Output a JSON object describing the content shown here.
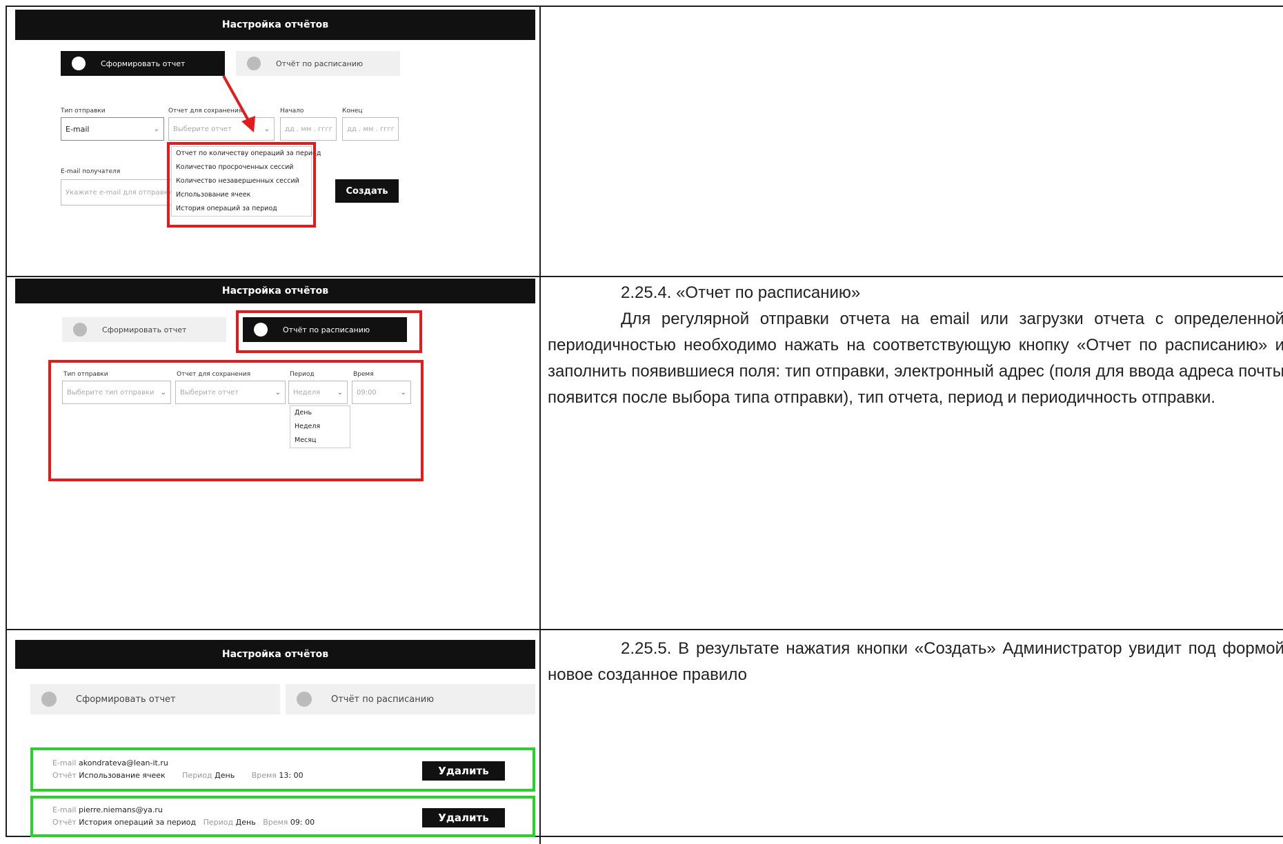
{
  "app_header": "Настройка отчётов",
  "toggle_generate": "Сформировать отчет",
  "toggle_schedule": "Отчёт по расписанию",
  "shot1": {
    "labels": {
      "send_type": "Тип отправки",
      "report": "Отчет для сохранения",
      "start": "Начало",
      "end": "Конец",
      "email": "E-mail получателя"
    },
    "send_type_value": "E-mail",
    "report_placeholder": "Выберите отчет",
    "date_placeholder": "дд . мм . гггг",
    "email_placeholder": "Укажите e-mail для отправки",
    "report_options": [
      "Отчет по количеству операций за период",
      "Количество просроченных сессий",
      "Количество незавершенных сессий",
      "Использование ячеек",
      "История операций за период"
    ],
    "create_label": "Создать"
  },
  "shot2": {
    "labels": {
      "send_type": "Тип отправки",
      "report": "Отчет для сохранения",
      "period": "Период",
      "time": "Время"
    },
    "send_type_placeholder": "Выберите тип отправки",
    "report_placeholder": "Выберите отчет",
    "period_value": "Неделя",
    "time_value": "09:00",
    "period_options": [
      "День",
      "Неделя",
      "Месяц"
    ]
  },
  "shot3": {
    "rules": [
      {
        "email_key": "E-mail",
        "email": "akondrateva@lean-it.ru",
        "report_key": "Отчёт",
        "report": "Использование ячеек",
        "period_key": "Период",
        "period": "День",
        "time_key": "Время",
        "time": "13: 00",
        "delete_label": "Удалить"
      },
      {
        "email_key": "E-mail",
        "email": "pierre.niemans@ya.ru",
        "report_key": "Отчёт",
        "report": "История операций за период",
        "period_key": "Период",
        "period": "День",
        "time_key": "Время",
        "time": "09: 00",
        "delete_label": "Удалить"
      }
    ]
  },
  "text": {
    "section_2254_title": "2.25.4. «Отчет по расписанию»",
    "section_2254_body": "Для регулярной отправки отчета на email или загрузки отчета с определенной периодичностью необходимо нажать на соответствующую кнопку «Отчет по расписанию» и заполнить появившиеся поля: тип отправки, электронный адрес (поля для ввода адреса почты появится после выбора типа отправки), тип отчета, период и периодичность отправки.",
    "section_2255_body": "2.25.5. В результате нажатия кнопки «Создать» Администратор увидит под формой новое созданное правило"
  },
  "colors": {
    "highlight_red": "#e31b1b",
    "highlight_green": "#2bd12b",
    "dark": "#111111"
  }
}
